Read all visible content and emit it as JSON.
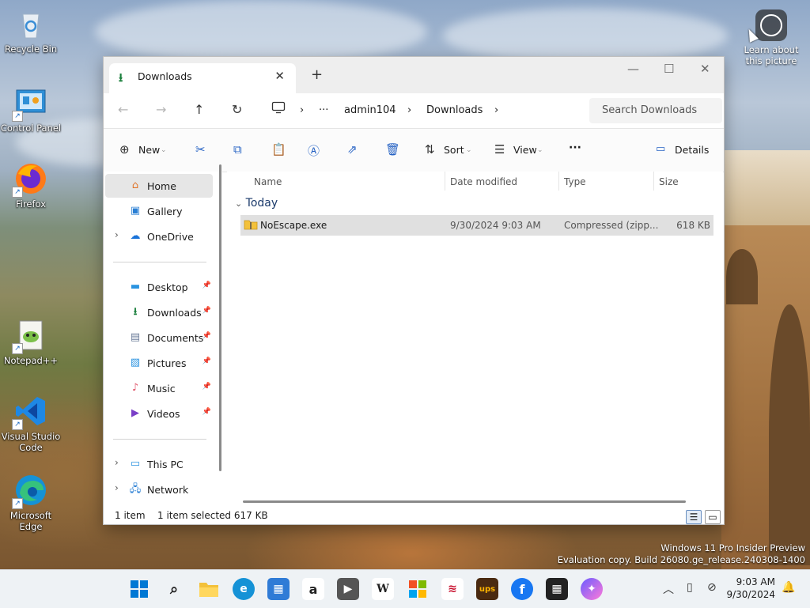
{
  "desktop": {
    "icons": [
      {
        "label": "Recycle Bin",
        "icon": "recycle-bin-icon"
      },
      {
        "label": "Control Panel",
        "icon": "control-panel-icon"
      },
      {
        "label": "Firefox",
        "icon": "firefox-icon"
      },
      {
        "label": "Notepad++",
        "icon": "notepad-plus-plus-icon"
      },
      {
        "label": "Visual Studio Code",
        "icon": "vscode-icon"
      },
      {
        "label": "Microsoft Edge",
        "icon": "edge-icon"
      }
    ],
    "learn_about": "Learn about this picture",
    "watermark_line1": "Windows 11 Pro Insider Preview",
    "watermark_line2": "Evaluation copy. Build 26080.ge_release.240308-1400"
  },
  "explorer": {
    "tab_title": "Downloads",
    "new_tab": "+",
    "window_controls": {
      "minimize": "—",
      "maximize": "☐",
      "close": "✕"
    },
    "breadcrumb": [
      "admin104",
      "Downloads"
    ],
    "breadcrumb_more": "···",
    "search_placeholder": "Search Downloads",
    "toolbar": {
      "new_label": "New",
      "sort_label": "Sort",
      "view_label": "View",
      "more_label": "···",
      "details_label": "Details"
    },
    "sidebar": {
      "home": "Home",
      "gallery": "Gallery",
      "onedrive": "OneDrive",
      "quick": [
        "Desktop",
        "Downloads",
        "Documents",
        "Pictures",
        "Music",
        "Videos"
      ],
      "this_pc": "This PC",
      "network": "Network"
    },
    "columns": {
      "name": "Name",
      "date": "Date modified",
      "type": "Type",
      "size": "Size"
    },
    "group": "Today",
    "files": [
      {
        "name": "NoEscape.exe",
        "date": "9/30/2024 9:03 AM",
        "type": "Compressed (zipp...",
        "size": "618 KB"
      }
    ],
    "status": {
      "count": "1 item",
      "selected": "1 item selected  617 KB"
    }
  },
  "taskbar": {
    "time": "9:03 AM",
    "date": "9/30/2024"
  },
  "colors": {
    "accent": "#0067c0",
    "folder": "#f3c13a"
  }
}
